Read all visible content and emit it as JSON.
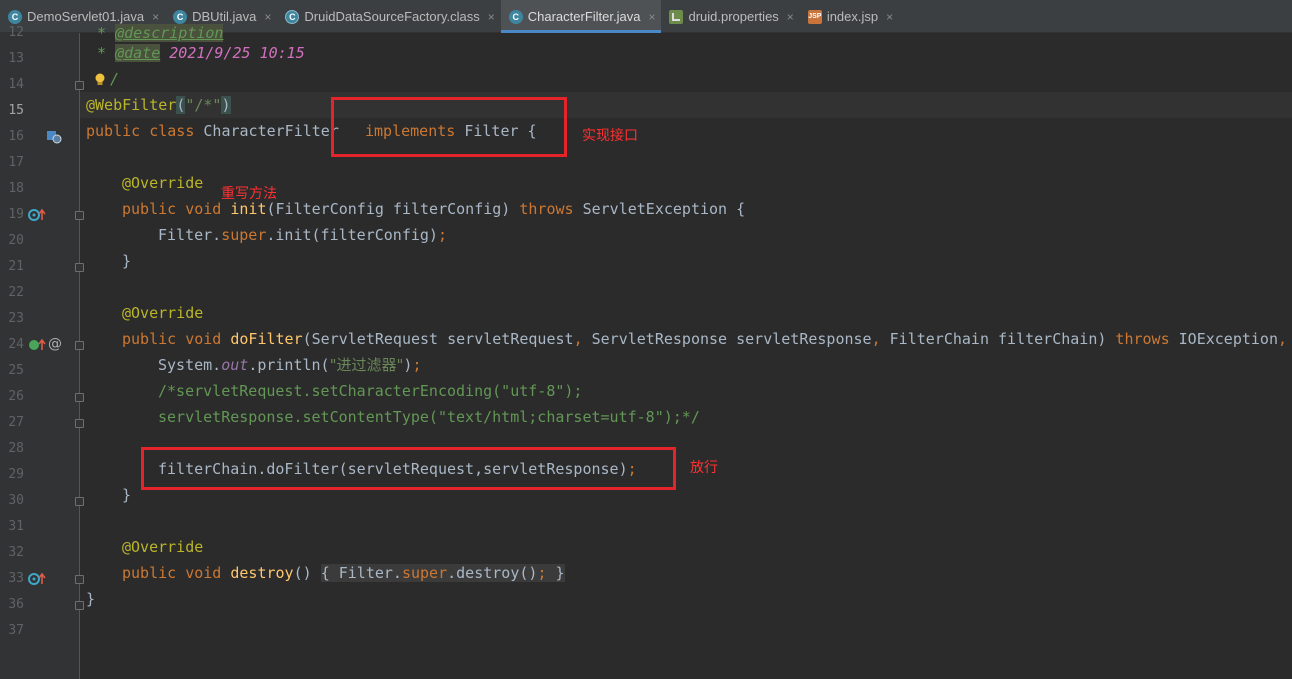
{
  "tabs": [
    {
      "label": "DemoServlet01.java",
      "icon": "java-class-icon",
      "active": false
    },
    {
      "label": "DBUtil.java",
      "icon": "java-class-icon",
      "active": false
    },
    {
      "label": "DruidDataSourceFactory.class",
      "icon": "compiled-class-icon",
      "active": false
    },
    {
      "label": "CharacterFilter.java",
      "icon": "java-class-icon",
      "active": true
    },
    {
      "label": "druid.properties",
      "icon": "properties-file-icon",
      "active": false
    },
    {
      "label": "index.jsp",
      "icon": "jsp-file-icon",
      "active": false
    }
  ],
  "tab_close_glyph": "×",
  "file_icon_letter": "C",
  "jsp_icon_text": "JSP",
  "line_numbers": [
    "12",
    "13",
    "14",
    "15",
    "16",
    "17",
    "18",
    "19",
    "20",
    "21",
    "22",
    "23",
    "24",
    "25",
    "26",
    "27",
    "28",
    "29",
    "30",
    "31",
    "32",
    "33",
    "36",
    "37"
  ],
  "code": {
    "l12_tag": "@description",
    "l13_star": " * ",
    "l13_tag": "@date",
    "l13_val": " 2021/9/25 10:15",
    "l14_end": "/",
    "l15_ann": "@WebFilter",
    "l15_open": "(",
    "l15_str": "\"/*\"",
    "l15_close": ")",
    "l16_kw": "public class ",
    "l16_name": "CharacterFilter",
    "l16_impl": "implements ",
    "l16_iface": "Filter {",
    "override": "@Override",
    "l19_kw": "public void ",
    "l19_fn": "init",
    "l19_params": "(FilterConfig filterConfig) ",
    "l19_throws": "throws ",
    "l19_exc": "ServletException {",
    "l20_a": "Filter.",
    "l20_super": "super",
    "l20_b": ".init(filterConfig)",
    "semi": ";",
    "brace_close": "}",
    "l24_kw": "public void ",
    "l24_fn": "doFilter",
    "l24_p1": "(ServletRequest servletRequest",
    "l24_p2": " ServletResponse servletResponse",
    "l24_p3": " FilterChain filterChain) ",
    "l24_throws": "throws ",
    "l24_exc": "IOException",
    "comma": ",",
    "l25_a": "System.",
    "l25_out": "out",
    "l25_b": ".println(",
    "l25_str": "\"进过滤器\"",
    "l25_c": ")",
    "l26": "/*servletRequest.setCharacterEncoding(\"utf-8\");",
    "l27": "servletResponse.setContentType(\"text/html;charset=utf-8\");*/",
    "l29": "filterChain.doFilter(servletRequest,servletResponse)",
    "l33_kw": "public void ",
    "l33_fn": "destroy",
    "l33_paren": "()",
    "l33_open": "{",
    "l33_a": " Filter.",
    "l33_super": "super",
    "l33_b": ".destroy()",
    "l33_close": "}"
  },
  "annotations": {
    "implement_interface": "实现接口",
    "override_method": "重写方法",
    "pass_through": "放行"
  },
  "colors": {
    "background": "#2b2b2b",
    "keyword": "#cc7832",
    "annotation": "#bbb529",
    "string": "#6a8759",
    "method": "#ffc66d",
    "highlight_red": "#e3242b"
  }
}
